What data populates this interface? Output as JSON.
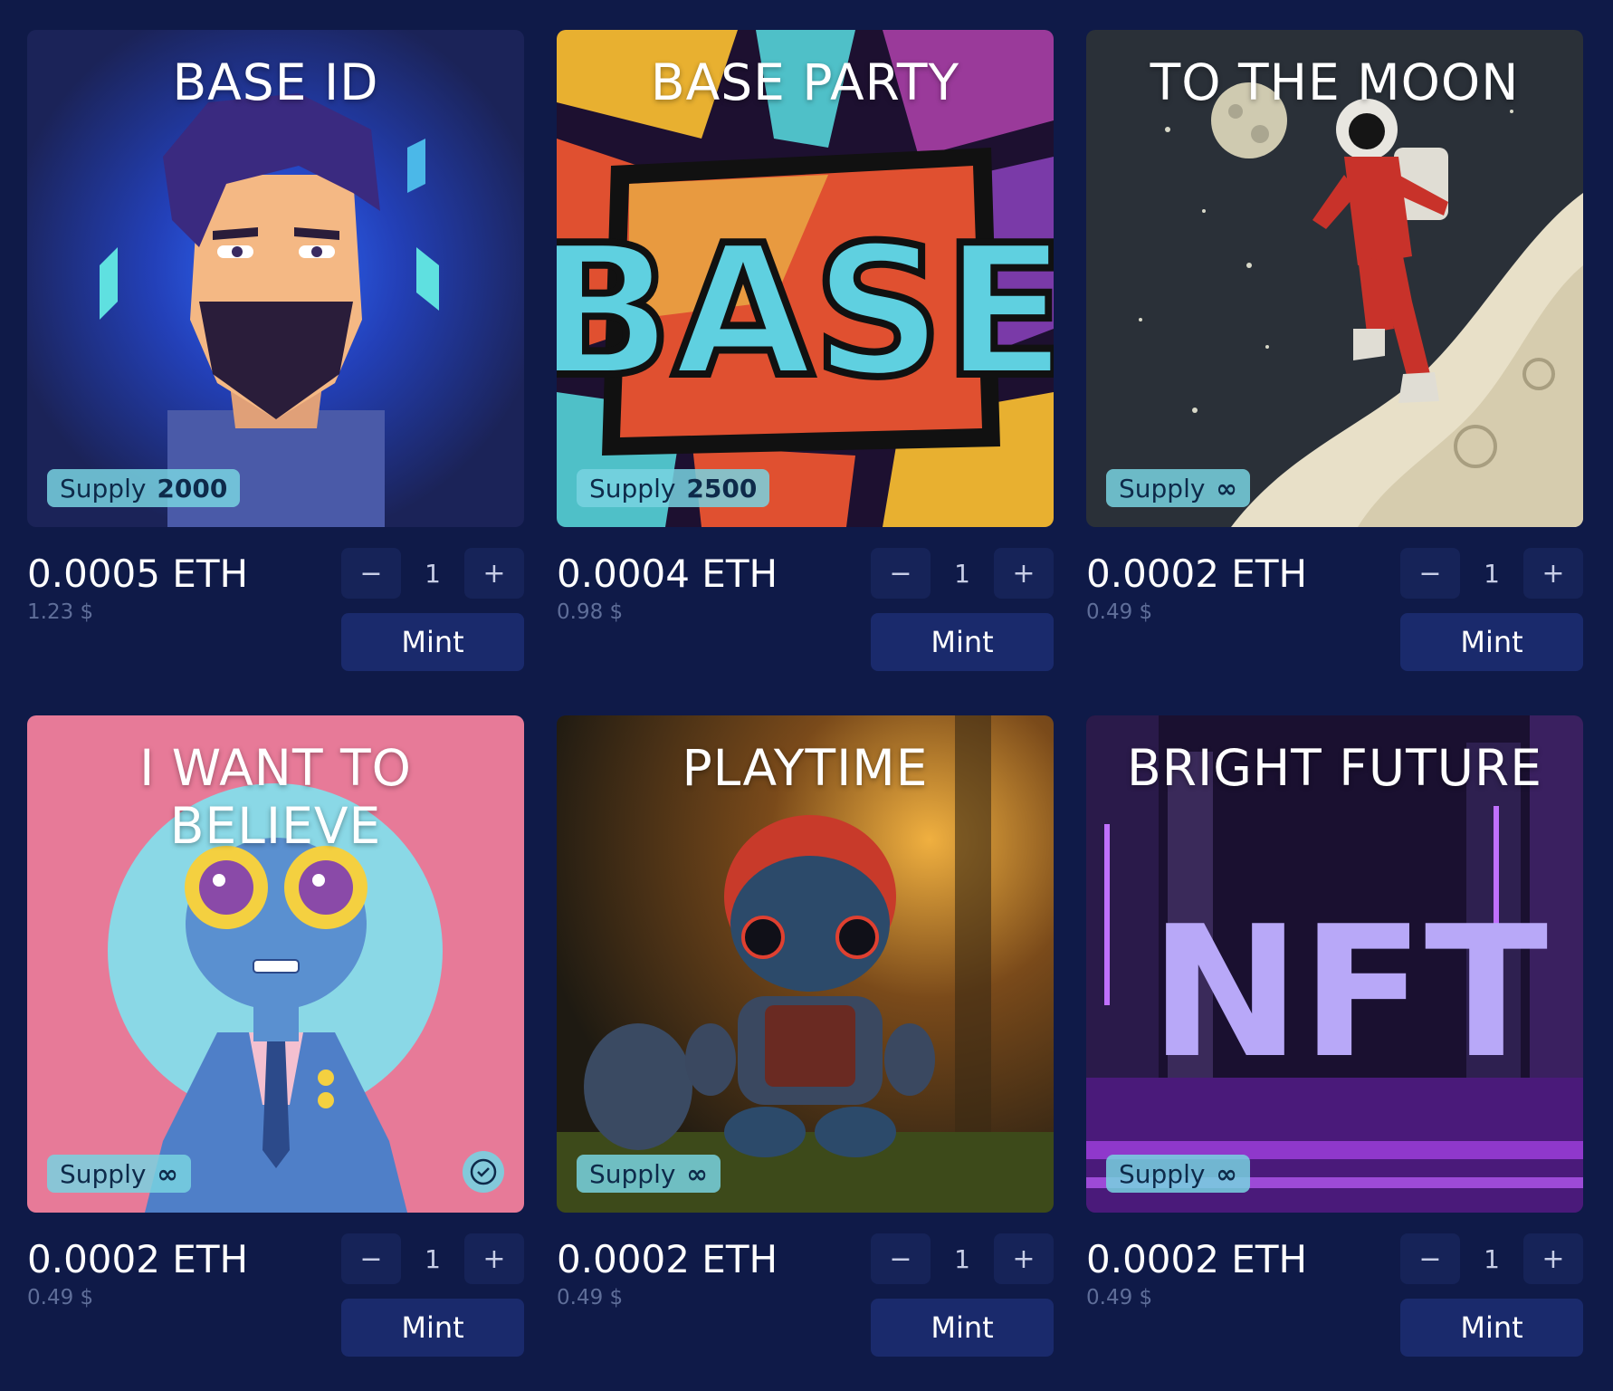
{
  "cards": [
    {
      "title": "BASE ID",
      "supply_label": "Supply",
      "supply_value": "2000",
      "price": "0.0005 ETH",
      "usd": "1.23 $",
      "qty": "1",
      "minus": "−",
      "plus": "+",
      "mint_label": "Mint",
      "owned": false
    },
    {
      "title": "BASE PARTY",
      "supply_label": "Supply",
      "supply_value": "2500",
      "price": "0.0004 ETH",
      "usd": "0.98 $",
      "qty": "1",
      "minus": "−",
      "plus": "+",
      "mint_label": "Mint",
      "owned": false
    },
    {
      "title": "TO THE MOON",
      "supply_label": "Supply",
      "supply_value": "∞",
      "price": "0.0002 ETH",
      "usd": "0.49 $",
      "qty": "1",
      "minus": "−",
      "plus": "+",
      "mint_label": "Mint",
      "owned": false
    },
    {
      "title": "I WANT TO BELIEVE",
      "supply_label": "Supply",
      "supply_value": "∞",
      "price": "0.0002 ETH",
      "usd": "0.49 $",
      "qty": "1",
      "minus": "−",
      "plus": "+",
      "mint_label": "Mint",
      "owned": true
    },
    {
      "title": "PLAYTIME",
      "supply_label": "Supply",
      "supply_value": "∞",
      "price": "0.0002 ETH",
      "usd": "0.49 $",
      "qty": "1",
      "minus": "−",
      "plus": "+",
      "mint_label": "Mint",
      "owned": false
    },
    {
      "title": "BRIGHT FUTURE",
      "supply_label": "Supply",
      "supply_value": "∞",
      "price": "0.0002 ETH",
      "usd": "0.49 $",
      "qty": "1",
      "minus": "−",
      "plus": "+",
      "mint_label": "Mint",
      "owned": false
    }
  ],
  "art_text": {
    "party": "BASE",
    "future": "NFT"
  },
  "colors": {
    "background": "#0f1a48",
    "button": "#1a2a6c",
    "stepper": "#162358",
    "badge": "#78d2e1"
  }
}
